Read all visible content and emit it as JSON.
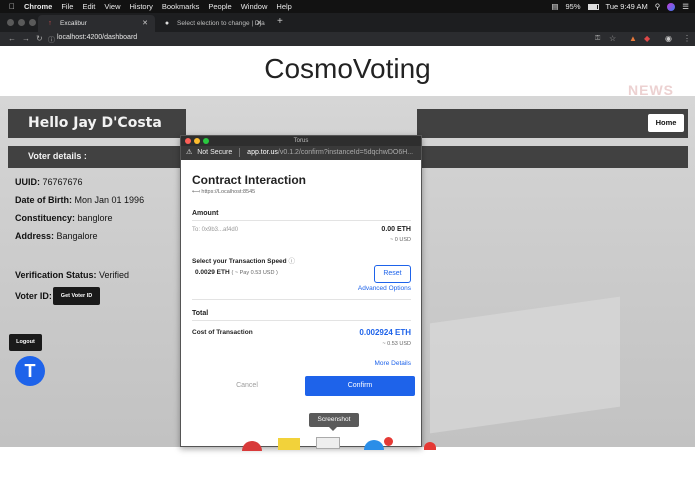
{
  "menubar": {
    "items": [
      "Chrome",
      "File",
      "Edit",
      "View",
      "History",
      "Bookmarks",
      "People",
      "Window",
      "Help"
    ],
    "battery": "95%",
    "clock": "Tue 9:49 AM"
  },
  "tabs": [
    {
      "label": "Excalibur"
    },
    {
      "label": "Select election to change | Dja"
    }
  ],
  "address": {
    "url": "localhost:4200/dashboard"
  },
  "page": {
    "title": "CosmoVoting",
    "greeting": "Hello Jay D'Costa",
    "home_label": "Home",
    "voter_details_label": "Voter details :",
    "uuid_label": "UUID:",
    "uuid": "76767676",
    "dob_label": "Date of Birth:",
    "dob": "Mon Jan 01 1996",
    "constituency_label": "Constituency:",
    "constituency": "banglore",
    "address_label": "Address:",
    "address": "Bangalore",
    "verification_label": "Verification Status:",
    "verification": "Verified",
    "voter_id_label": "Voter ID:",
    "get_voter_id_label": "Get Voter ID",
    "logout_label": "Logout",
    "news_watermark": "NEWS"
  },
  "popup": {
    "window_title": "Torus",
    "not_secure": "Not Secure",
    "url_host": "app.tor.us",
    "url_path": "/v0.1.2/confirm?instanceId=5dqchwDO6H...",
    "heading": "Contract Interaction",
    "origin": "https://Localhost:8545",
    "amount_label": "Amount",
    "to_address": "To: 0x9b3...af4d0",
    "amount_eth": "0.00 ETH",
    "amount_usd": "~ 0 USD",
    "speed_label": "Select your Transaction Speed",
    "speed_value": "0.0029 ETH",
    "speed_pay": "( ~ Pay 0.53 USD )",
    "reset_label": "Reset",
    "advanced_label": "Advanced Options",
    "total_label": "Total",
    "cost_label": "Cost of Transaction",
    "cost_eth": "0.002924 ETH",
    "cost_usd": "~ 0.53 USD",
    "more_details": "More Details",
    "cancel_label": "Cancel",
    "confirm_label": "Confirm"
  },
  "tooltip": "Screenshot",
  "colors": {
    "torus_blue": "#1e63ea",
    "dark_bar": "#414141"
  }
}
